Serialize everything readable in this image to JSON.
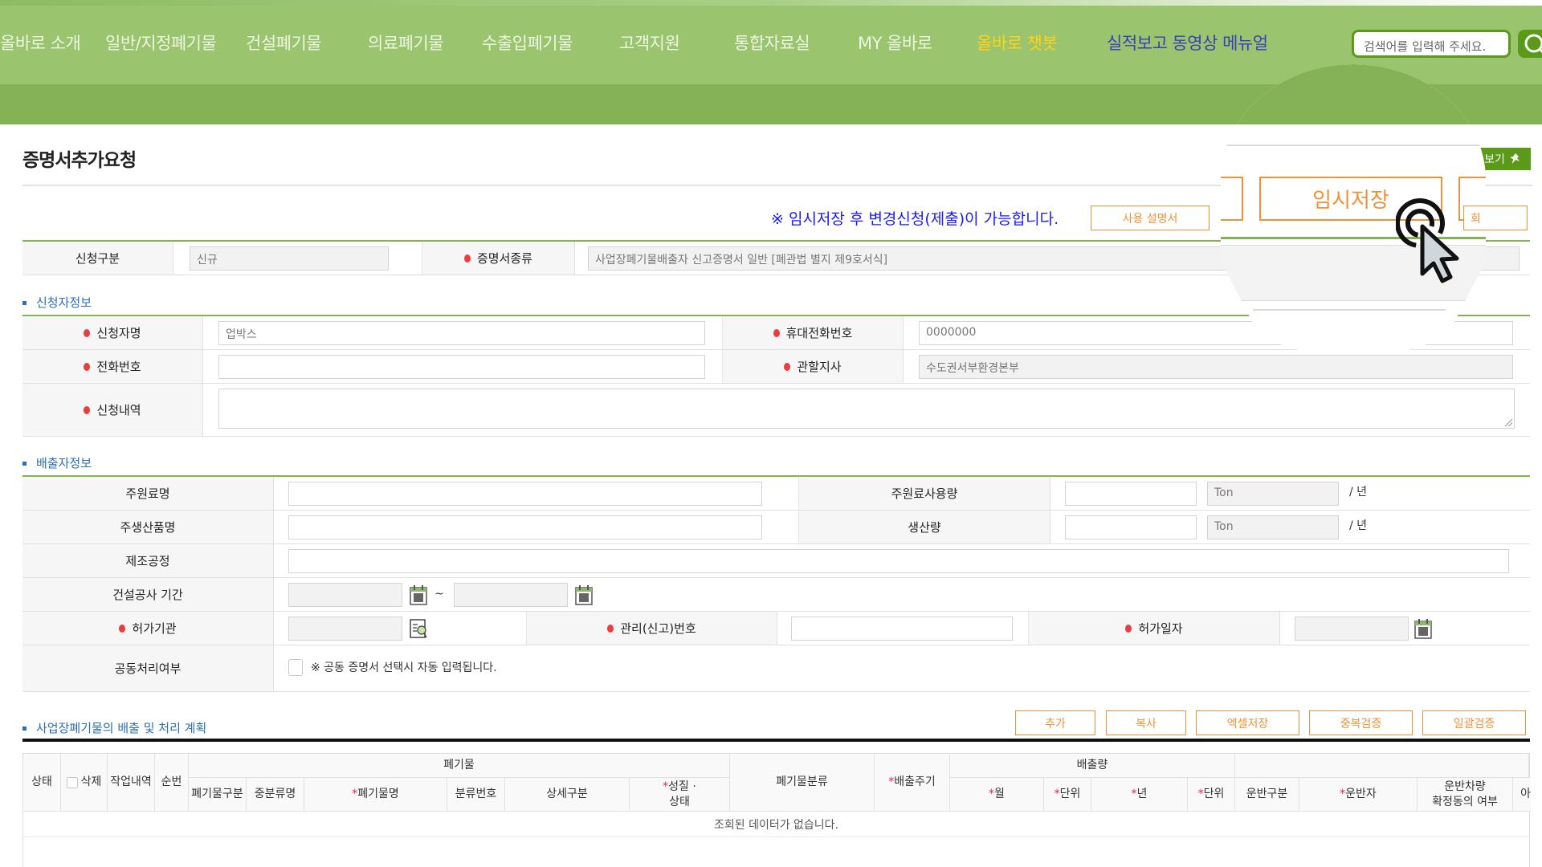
{
  "nav": {
    "items": [
      {
        "label": "올바로 소개"
      },
      {
        "label": "일반/지정폐기물"
      },
      {
        "label": "건설폐기물"
      },
      {
        "label": "의료폐기물"
      },
      {
        "label": "수출입폐기물"
      },
      {
        "label": "고객지원"
      },
      {
        "label": "통합자료실"
      },
      {
        "label": "MY 올바로"
      },
      {
        "label": "올바로 챗봇"
      },
      {
        "label": "실적보고 동영상 메뉴얼"
      }
    ],
    "search_placeholder": "검색어를 입력해 주세요.",
    "search_icon": "search-icon"
  },
  "colors": {
    "nav_green": "#9ac46e",
    "subbar_green": "#86b257",
    "accent_orange": "#f0913a",
    "chatbot_yellow": "#ffd21a",
    "manual_blue": "#3a3fb5",
    "notice_blue": "#1a1aff",
    "section_blue": "#2a6fb8",
    "required_red": "#ef3b3b"
  },
  "page": {
    "title": "증명서추가요청",
    "notice": "※ 임시저장 후 변경신청(제출)이 가능합니다.",
    "manual_button": "사용 설명서",
    "temp_save_button": "임시저장",
    "lookup_button_partial": "회",
    "view_button": "보기"
  },
  "basic": {
    "req_type_label": "신청구분",
    "req_type_value": "신규",
    "cert_type_label": "증명서종류",
    "cert_type_value": "사업장폐기물배출자 신고증명서 일반 [폐관법 별지 제9호서식]"
  },
  "applicant": {
    "section_title": "신청자정보",
    "name_label": "신청자명",
    "name_value": "업박스",
    "mobile_label": "휴대전화번호",
    "mobile_value": "0000000",
    "phone_label": "전화번호",
    "phone_value": "",
    "branch_label": "관할지사",
    "branch_value": "수도권서부환경본부",
    "details_label": "신청내역",
    "details_value": ""
  },
  "discharger": {
    "section_title": "배출자정보",
    "main_material_label": "주원료명",
    "main_material_usage_label": "주원료사용량",
    "main_product_label": "주생산품명",
    "production_label": "생산량",
    "unit_value": "Ton",
    "per_year": "/ 년",
    "process_label": "제조공정",
    "construction_period_label": "건설공사 기간",
    "period_sep": "~",
    "permit_org_label": "허가기관",
    "mgmt_no_label": "관리(신고)번호",
    "permit_date_label": "허가일자",
    "joint_label": "공동처리여부",
    "joint_note": "※ 공동 증명서 선택시 자동 입력됩니다."
  },
  "plan": {
    "section_title": "사업장폐기물의 배출 및 처리 계획",
    "buttons": [
      "추가",
      "복사",
      "엑셀저장",
      "중복검증",
      "일괄검증"
    ],
    "headers": {
      "status": "상태",
      "delete": "삭제",
      "work": "작업내역",
      "seq": "순번",
      "waste_group": "폐기물",
      "waste_type": "폐기물구분",
      "mid_class": "중분류명",
      "waste_name": "폐기물명",
      "class_no": "분류번호",
      "detail": "상세구분",
      "property": "성질 ·",
      "property2": "상태",
      "waste_class": "폐기물분류",
      "cycle": "배출주기",
      "amount_group": "배출량",
      "month": "월",
      "unit1": "단위",
      "year": "년",
      "unit2": "단위",
      "transport_type": "운반구분",
      "transporter": "운반자",
      "vehicle1": "운반차량",
      "vehicle2": "확정동의 여부",
      "cut": "아"
    },
    "empty_message": "조회된 데이터가 없습니다."
  }
}
